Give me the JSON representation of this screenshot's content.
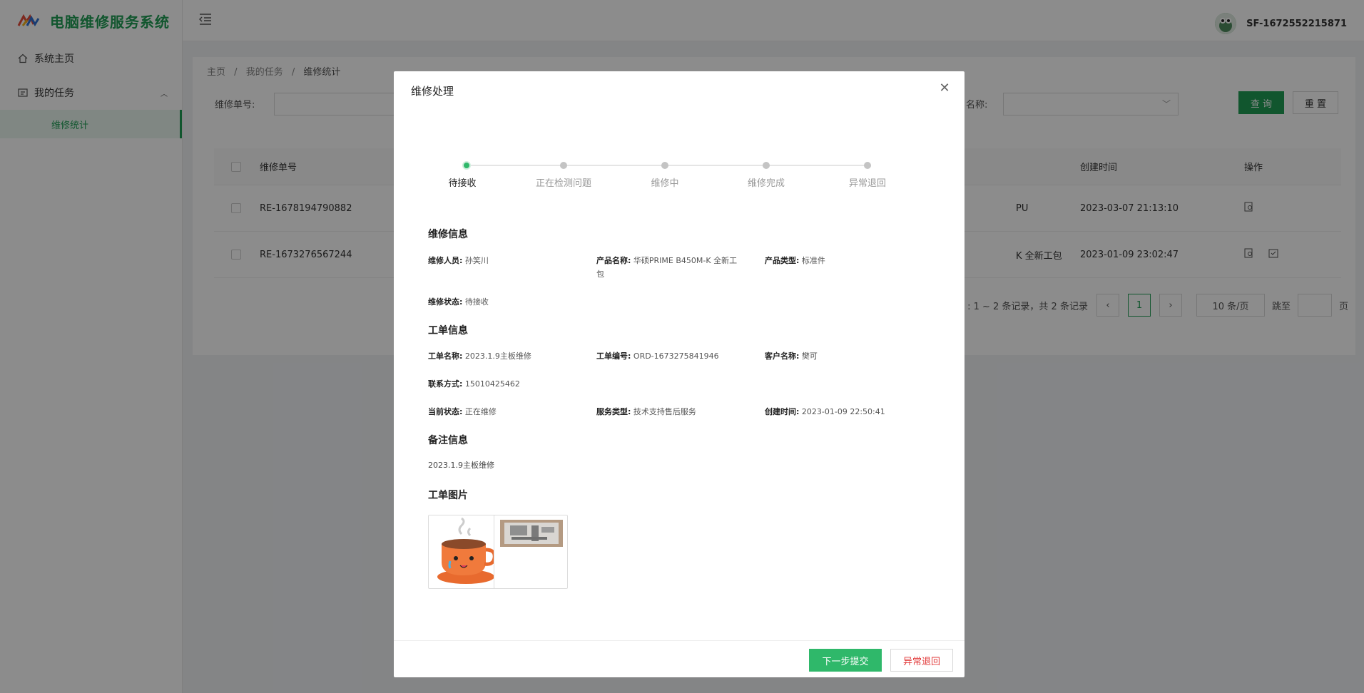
{
  "app": {
    "title": "电脑维修服务系统",
    "brand_color": "#1f9d55"
  },
  "sidebar": {
    "items": [
      {
        "label": "系统主页",
        "icon": "home-icon"
      },
      {
        "label": "我的任务",
        "icon": "task-icon"
      }
    ],
    "sub_item": "维修统计"
  },
  "header": {
    "username": "SF-1672552215871"
  },
  "breadcrumb": {
    "home": "主页",
    "sep": "/",
    "level2": "我的任务",
    "current": "维修统计"
  },
  "search": {
    "repair_no_label": "维修单号:",
    "name_label": "名称:",
    "query_button": "查 询",
    "reset_button": "重 置"
  },
  "table": {
    "headers": {
      "repair_no": "维修单号",
      "created": "创建时间",
      "action": "操作"
    },
    "rows": [
      {
        "repair_no": "RE-1678194790882",
        "partial": "PU",
        "created": "2023-03-07 21:13:10"
      },
      {
        "repair_no": "RE-1673276567244",
        "partial": "K 全新工包",
        "created": "2023-01-09 23:02:47"
      }
    ]
  },
  "pager": {
    "summary": ": 1 ~ 2 条记录，共 2 条记录",
    "current": "1",
    "page_size": "10 条/页",
    "jump_label": "跳至",
    "page_unit": "页"
  },
  "modal": {
    "title": "维修处理",
    "steps": [
      "待接收",
      "正在检测问题",
      "维修中",
      "维修完成",
      "异常退回"
    ],
    "active_step": 0,
    "repair_info": {
      "title": "维修信息",
      "staff_label": "维修人员:",
      "staff": "孙笑川",
      "product_label": "产品名称:",
      "product_line1": "华硕PRIME B450M-K 全新工",
      "product_line2": "包",
      "type_label": "产品类型:",
      "type": "标准件",
      "status_label": "维修状态:",
      "status": "待接收"
    },
    "order_info": {
      "title": "工单信息",
      "name_label": "工单名称:",
      "name": "2023.1.9主板维修",
      "no_label": "工单编号:",
      "no": "ORD-1673275841946",
      "customer_label": "客户名称:",
      "customer": "樊可",
      "contact_label": "联系方式:",
      "contact": "15010425462",
      "state_label": "当前状态:",
      "state": "正在维修",
      "service_label": "服务类型:",
      "service": "技术支持售后服务",
      "created_label": "创建时间:",
      "created": "2023-01-09 22:50:41"
    },
    "note": {
      "title": "备注信息",
      "text": "2023.1.9主板维修"
    },
    "images": {
      "title": "工单图片"
    },
    "next_button": "下一步提交",
    "abnormal_button": "异常退回"
  }
}
